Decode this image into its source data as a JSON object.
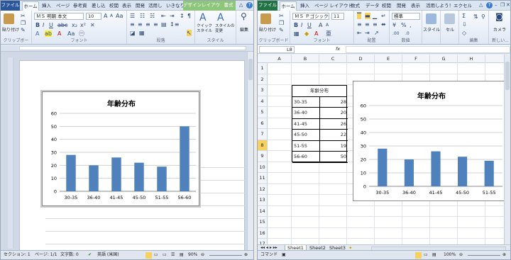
{
  "word": {
    "tabs": [
      "ファイル",
      "ホーム",
      "挿入",
      "ページ",
      "参考資",
      "差し込",
      "校閲",
      "表示",
      "開発",
      "活用し",
      "いきなり",
      "デザイン",
      "レイアウト",
      "書式"
    ],
    "font_name": "ＭＳ 明朝 本文",
    "font_size": "10",
    "groups": [
      "クリップボー",
      "フォント",
      "段落",
      "スタイル",
      "編集"
    ],
    "paste_label": "貼り付け",
    "quick_style": "クイック\nスタイル",
    "change_style": "スタイルの\n変更",
    "edit_label": "編集",
    "status": {
      "section": "セクション: 1",
      "page": "ページ: 1/1",
      "chars": "文字数: 0",
      "lang": "英語 (米国)",
      "zoom": "90%"
    }
  },
  "excel": {
    "tabs": [
      "ファイル",
      "ホーム",
      "挿入",
      "ページ レイアウト",
      "数式",
      "データ",
      "校閲",
      "開発",
      "表示",
      "活用しよう！エクセル"
    ],
    "font_name": "ＭＳ Ｐゴシック",
    "font_size": "11",
    "number_format": "標準",
    "groups": [
      "クリップボード",
      "フォント",
      "配置",
      "数値",
      "セル",
      "編集",
      "新しい..."
    ],
    "paste_label": "貼り付け",
    "style_label": "スタイル",
    "cell_label": "セル",
    "edit_label": "編集",
    "camera_label": "カメラ",
    "name_box": "L8",
    "formula_fx": "fx",
    "columns": [
      "A",
      "B",
      "C",
      "D",
      "E",
      "F",
      "G",
      "H"
    ],
    "rows": [
      "1",
      "2",
      "3",
      "4",
      "5",
      "6",
      "7",
      "8",
      "9",
      "10",
      "11",
      "12",
      "13",
      "14",
      "15",
      "16",
      "17"
    ],
    "table_title": "年齢分布",
    "table": [
      [
        "30-35",
        "28"
      ],
      [
        "36-40",
        "20"
      ],
      [
        "41-45",
        "26"
      ],
      [
        "45-50",
        "22"
      ],
      [
        "51-55",
        "19"
      ],
      [
        "56-60",
        "50"
      ]
    ],
    "sheets": [
      "Sheet1",
      "Sheet2",
      "Sheet3"
    ],
    "status": {
      "mode": "コマンド",
      "zoom": "100%"
    }
  },
  "chart_data": [
    {
      "type": "bar",
      "title": "年齢分布",
      "categories": [
        "30-35",
        "36-40",
        "41-45",
        "45-50",
        "51-55",
        "56-60"
      ],
      "values": [
        28,
        20,
        26,
        22,
        19,
        50
      ],
      "ylim": [
        0,
        60
      ],
      "yticks": [
        0,
        10,
        20,
        30,
        40,
        50,
        60
      ],
      "grid": true,
      "bar_color": "#4f81bd"
    },
    {
      "type": "bar",
      "title": "年齢分布",
      "categories": [
        "30-35",
        "36-40",
        "41-45",
        "45-50",
        "51-55"
      ],
      "values": [
        28,
        20,
        26,
        22,
        19
      ],
      "ylim": [
        0,
        60
      ],
      "yticks": [
        0,
        10,
        20,
        30,
        40,
        50,
        60
      ],
      "grid": true,
      "bar_color": "#4f81bd"
    }
  ],
  "colors": {
    "word_file": "#2b579a",
    "excel_file": "#217346",
    "context_tab": "#8dc67a",
    "accent": "#4f81bd"
  }
}
